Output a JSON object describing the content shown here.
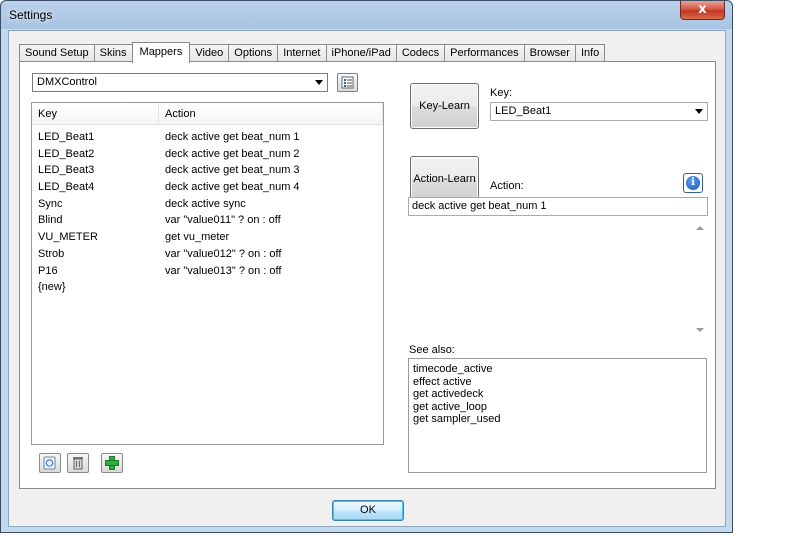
{
  "window": {
    "title": "Settings",
    "close_glyph": "x"
  },
  "tabs": [
    {
      "label": "Sound Setup"
    },
    {
      "label": "Skins"
    },
    {
      "label": "Mappers"
    },
    {
      "label": "Video"
    },
    {
      "label": "Options"
    },
    {
      "label": "Internet"
    },
    {
      "label": "iPhone/iPad"
    },
    {
      "label": "Codecs"
    },
    {
      "label": "Performances"
    },
    {
      "label": "Browser"
    },
    {
      "label": "Info"
    }
  ],
  "active_tab": "Mappers",
  "mapper": {
    "selected": "DMXControl",
    "options_icon": "list-icon"
  },
  "list": {
    "headers": {
      "key": "Key",
      "action": "Action"
    },
    "rows": [
      {
        "key": "LED_Beat1",
        "action": "deck active get beat_num 1"
      },
      {
        "key": "LED_Beat2",
        "action": "deck active get beat_num 2"
      },
      {
        "key": "LED_Beat3",
        "action": "deck active get beat_num 3"
      },
      {
        "key": "LED_Beat4",
        "action": "deck active get beat_num 4"
      },
      {
        "key": "Sync",
        "action": "deck active sync"
      },
      {
        "key": "Blind",
        "action": "var \"value011\" ? on : off"
      },
      {
        "key": "VU_METER",
        "action": "get vu_meter"
      },
      {
        "key": "Strob",
        "action": "var \"value012\" ? on : off"
      },
      {
        "key": "P16",
        "action": "var \"value013\" ? on : off"
      },
      {
        "key": "{new}",
        "action": ""
      }
    ]
  },
  "list_buttons": {
    "reset_icon": "reset-icon",
    "delete_icon": "trash-icon",
    "add_icon": "plus-icon"
  },
  "key_learn": {
    "button": "Key-Learn",
    "label": "Key:",
    "value": "LED_Beat1"
  },
  "action_learn": {
    "button": "Action-Learn",
    "label": "Action:",
    "value": "deck active get beat_num 1"
  },
  "info_icon": {
    "glyph": "i"
  },
  "see_also": {
    "label": "See also:",
    "items": [
      "timecode_active",
      "effect active",
      "get activedeck",
      "get active_loop",
      "get sampler_used"
    ]
  },
  "ok_button": "OK"
}
